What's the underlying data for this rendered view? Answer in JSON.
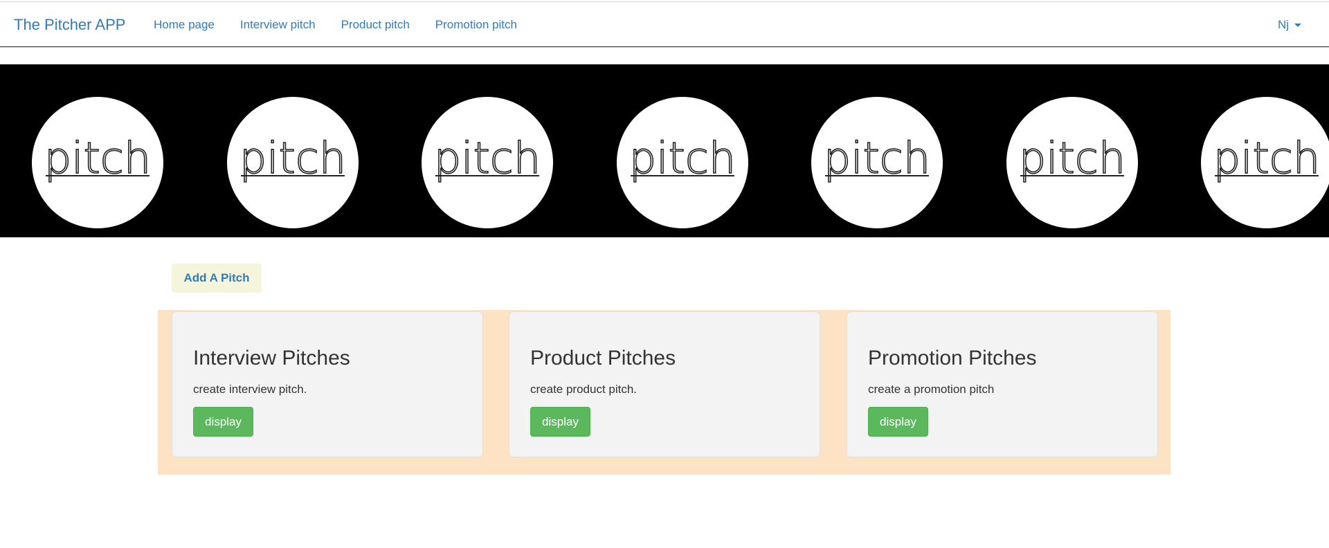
{
  "navbar": {
    "brand": "The Pitcher APP",
    "links": [
      {
        "label": "Home page"
      },
      {
        "label": "Interview pitch"
      },
      {
        "label": "Product pitch"
      },
      {
        "label": "Promotion pitch"
      }
    ],
    "user": "Nj",
    "user_icon": "caret-down-icon"
  },
  "banner": {
    "logo_text": "pitch",
    "logo_count": 7,
    "background": "#000000"
  },
  "actions": {
    "add_label": "Add A Pitch"
  },
  "cards": [
    {
      "title": "Interview Pitches",
      "text": "create interview pitch.",
      "button": "display"
    },
    {
      "title": "Product Pitches",
      "text": "create product pitch.",
      "button": "display"
    },
    {
      "title": "Promotion Pitches",
      "text": "create a promotion pitch",
      "button": "display"
    }
  ],
  "colors": {
    "link": "#337ab7",
    "success": "#5cb85c",
    "cards_background": "#fde2c4",
    "card": "#f3f3f3",
    "add_button": "#f5f5dc"
  }
}
